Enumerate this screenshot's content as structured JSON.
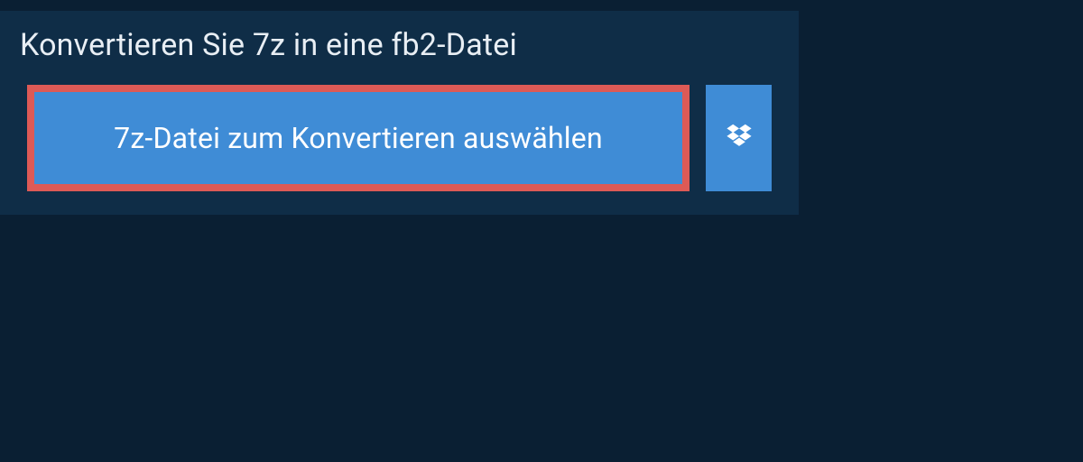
{
  "title": "Konvertieren Sie 7z in eine fb2-Datei",
  "actions": {
    "select_file_label": "7z-Datei zum Konvertieren auswählen"
  },
  "colors": {
    "background": "#0a1f33",
    "panel": "#0f2d47",
    "button": "#3f8cd6",
    "highlight_border": "#dd5a56",
    "text_light": "#e8eef4"
  },
  "icons": {
    "dropbox": "dropbox-icon"
  }
}
